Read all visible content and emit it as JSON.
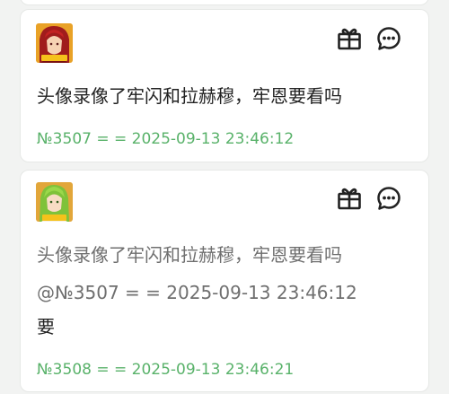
{
  "posts": [
    {
      "body": "头像录像了牢闪和拉赫穆，牢恩要看吗",
      "meta": "№3507 = = 2025-09-13 23:46:12"
    },
    {
      "quote_text": "头像录像了牢闪和拉赫穆，牢恩要看吗",
      "quote_meta": "@№3507 = = 2025-09-13 23:46:12",
      "body": "要",
      "meta": "№3508 = = 2025-09-13 23:46:21"
    }
  ],
  "colors": {
    "meta_green": "#59b26a",
    "body_text": "#222222",
    "quote_text": "#6f6f6f",
    "card_bg": "#ffffff",
    "page_bg": "#f2f3f2"
  },
  "icons": {
    "gift": "gift-icon",
    "comment": "comment-icon"
  }
}
